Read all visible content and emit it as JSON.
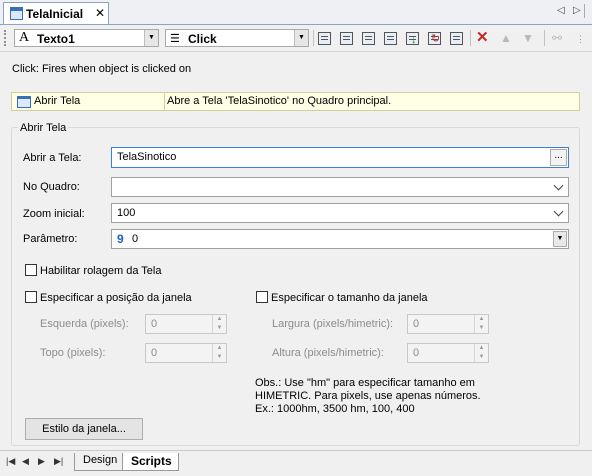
{
  "document_tab": {
    "title": "TelaInicial",
    "close": "✕"
  },
  "tab_nav": {
    "prev": "◁",
    "next": "▷"
  },
  "toolbar": {
    "object_combo": {
      "icon_glyph": "A",
      "value": "Texto1"
    },
    "event_combo": {
      "value": "Click"
    },
    "icons": [
      "script-add-icon",
      "script-edit-icon",
      "script-image-icon",
      "script-list-icon",
      "script-down-icon",
      "script-refresh-icon",
      "print-icon",
      "delete-icon",
      "move-up-icon",
      "move-down-icon",
      "link-icon"
    ]
  },
  "event_description": "Click: Fires when object is clicked on",
  "action": {
    "name": "Abrir Tela",
    "description": "Abre a Tela 'TelaSinotico' no Quadro principal."
  },
  "group": {
    "title": "Abrir Tela",
    "abrir_tela": {
      "label": "Abrir a Tela:",
      "value": "TelaSinotico",
      "button": "..."
    },
    "no_quadro": {
      "label": "No Quadro:",
      "value": ""
    },
    "zoom": {
      "label": "Zoom inicial:",
      "value": "100"
    },
    "parametro": {
      "label": "Parâmetro:",
      "type_glyph": "9",
      "value": "0"
    },
    "rolagem": {
      "label": "Habilitar rolagem da Tela",
      "checked": false
    },
    "posicao": {
      "label": "Especificar a posição da janela",
      "esquerda_label": "Esquerda (pixels):",
      "esquerda_value": "0",
      "topo_label": "Topo (pixels):",
      "topo_value": "0"
    },
    "tamanho": {
      "label": "Especificar o tamanho da janela",
      "largura_label": "Largura (pixels/himetric):",
      "largura_value": "0",
      "altura_label": "Altura (pixels/himetric):",
      "altura_value": "0"
    },
    "obs_lines": [
      "Obs.: Use \"hm\" para especificar tamanho em",
      "HIMETRIC. Para pixels, use apenas números.",
      "Ex.: 1000hm, 3500 hm, 100, 400"
    ],
    "estilo_button": "Estilo da janela..."
  },
  "bottom_tabs": {
    "design": "Design",
    "scripts": "Scripts"
  },
  "colors": {
    "accent": "#3a7fd5",
    "action_bg": "#ffffe6",
    "param_glyph": "#1f5fbf"
  }
}
